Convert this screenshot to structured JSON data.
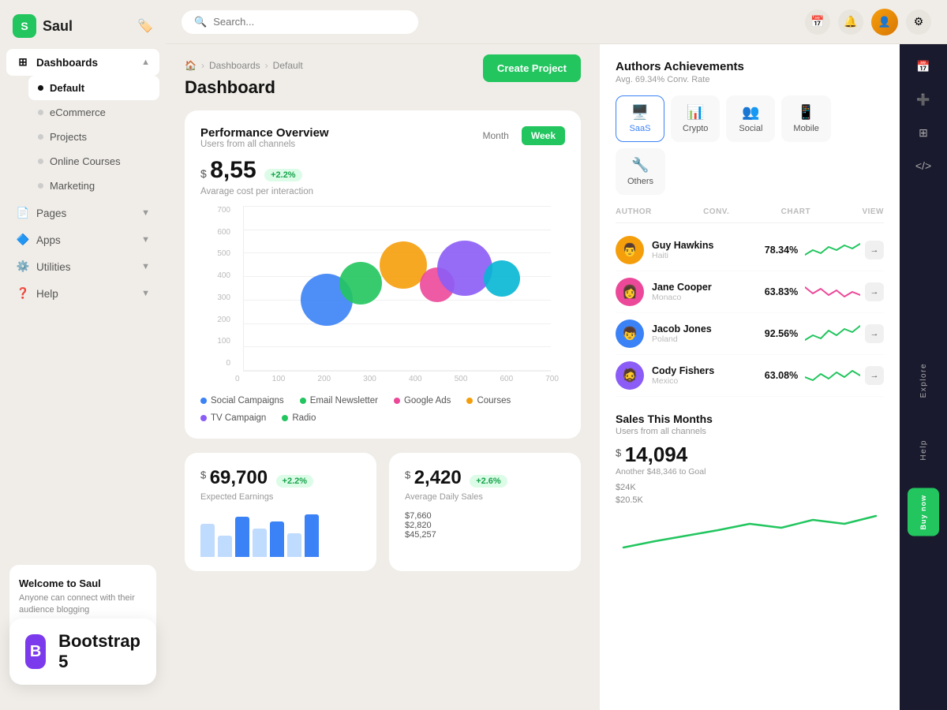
{
  "app": {
    "name": "Saul",
    "logo_letter": "S"
  },
  "header": {
    "search_placeholder": "Search...",
    "create_button": "Create Project"
  },
  "breadcrumb": {
    "home": "🏠",
    "parent": "Dashboards",
    "current": "Default"
  },
  "page": {
    "title": "Dashboard"
  },
  "sidebar": {
    "items": [
      {
        "label": "Dashboards",
        "icon": "⊞",
        "has_chevron": true,
        "active": true
      },
      {
        "label": "Default",
        "dot": true,
        "active": true,
        "sub": true
      },
      {
        "label": "eCommerce",
        "dot": true,
        "sub": true
      },
      {
        "label": "Projects",
        "dot": true,
        "sub": true
      },
      {
        "label": "Online Courses",
        "dot": true,
        "sub": true
      },
      {
        "label": "Marketing",
        "dot": true,
        "sub": true
      },
      {
        "label": "Pages",
        "icon": "📄",
        "has_chevron": true
      },
      {
        "label": "Apps",
        "icon": "🔷",
        "has_chevron": true
      },
      {
        "label": "Utilities",
        "icon": "⚙️",
        "has_chevron": true
      },
      {
        "label": "Help",
        "icon": "❓",
        "has_chevron": true
      }
    ],
    "welcome": {
      "title": "Welcome to Saul",
      "description": "Anyone can connect with their audience blogging"
    }
  },
  "performance": {
    "title": "Performance Overview",
    "subtitle": "Users from all channels",
    "tabs": [
      "Month",
      "Week"
    ],
    "active_tab": "Week",
    "metric": {
      "value": "8,55",
      "currency": "$",
      "change": "+2.2%",
      "label": "Avarage cost per interaction"
    },
    "y_axis": [
      "700",
      "600",
      "500",
      "400",
      "300",
      "200",
      "100",
      "0"
    ],
    "x_axis": [
      "0",
      "100",
      "200",
      "300",
      "400",
      "500",
      "600",
      "700"
    ],
    "bubbles": [
      {
        "x": 27,
        "y": 58,
        "size": 60,
        "color": "#3b82f6"
      },
      {
        "x": 38,
        "y": 48,
        "size": 50,
        "color": "#22c55e"
      },
      {
        "x": 52,
        "y": 38,
        "size": 55,
        "color": "#f59e0b"
      },
      {
        "x": 62,
        "y": 45,
        "size": 44,
        "color": "#ec4899"
      },
      {
        "x": 72,
        "y": 40,
        "size": 65,
        "color": "#8b5cf6"
      },
      {
        "x": 84,
        "y": 45,
        "size": 42,
        "color": "#06b6d4"
      }
    ],
    "legend": [
      {
        "label": "Social Campaigns",
        "color": "#3b82f6"
      },
      {
        "label": "Email Newsletter",
        "color": "#22c55e"
      },
      {
        "label": "Google Ads",
        "color": "#ec4899"
      },
      {
        "label": "Courses",
        "color": "#f59e0b"
      },
      {
        "label": "TV Campaign",
        "color": "#8b5cf6"
      },
      {
        "label": "Radio",
        "color": "#22c55e"
      }
    ]
  },
  "stats": [
    {
      "currency": "$",
      "value": "69,700",
      "change": "+2.2%",
      "label": "Expected Earnings"
    },
    {
      "currency": "$",
      "value": "2,420",
      "change": "+2.6%",
      "label": "Average Daily Sales"
    }
  ],
  "authors": {
    "title": "Authors Achievements",
    "subtitle": "Avg. 69.34% Conv. Rate",
    "categories": [
      {
        "label": "SaaS",
        "icon": "🖥️",
        "active": true
      },
      {
        "label": "Crypto",
        "icon": "📊"
      },
      {
        "label": "Social",
        "icon": "👥"
      },
      {
        "label": "Mobile",
        "icon": "📱"
      },
      {
        "label": "Others",
        "icon": "🔧"
      }
    ],
    "table_headers": {
      "author": "AUTHOR",
      "conv": "CONV.",
      "chart": "CHART",
      "view": "VIEW"
    },
    "rows": [
      {
        "name": "Guy Hawkins",
        "location": "Haiti",
        "conv": "78.34%",
        "color": "#f59e0b",
        "sparkColor": "#22c55e"
      },
      {
        "name": "Jane Cooper",
        "location": "Monaco",
        "conv": "63.83%",
        "color": "#ec4899",
        "sparkColor": "#ec4899"
      },
      {
        "name": "Jacob Jones",
        "location": "Poland",
        "conv": "92.56%",
        "color": "#3b82f6",
        "sparkColor": "#22c55e"
      },
      {
        "name": "Cody Fishers",
        "location": "Mexico",
        "conv": "63.08%",
        "color": "#8b5cf6",
        "sparkColor": "#22c55e"
      }
    ]
  },
  "sales": {
    "title": "Sales This Months",
    "subtitle": "Users from all channels",
    "currency": "$",
    "value": "14,094",
    "goal_text": "Another $48,346 to Goal",
    "sidebar_values": [
      "$7,660",
      "$2,820",
      "$45,257"
    ]
  },
  "right_strip": {
    "explore_label": "Explore",
    "help_label": "Help",
    "buy_label": "Buy now"
  },
  "bootstrap": {
    "icon": "B",
    "label": "Bootstrap 5"
  }
}
